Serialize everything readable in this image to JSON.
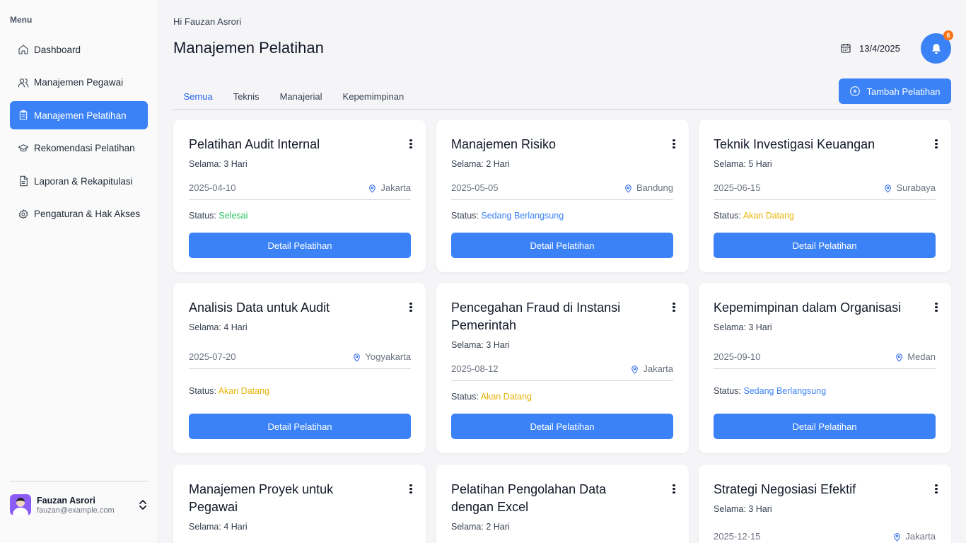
{
  "sidebar": {
    "menu_title": "Menu",
    "items": [
      {
        "label": "Dashboard",
        "icon": "home-icon"
      },
      {
        "label": "Manajemen Pegawai",
        "icon": "users-icon"
      },
      {
        "label": "Manajemen Pelatihan",
        "icon": "clipboard-icon",
        "active": true
      },
      {
        "label": "Rekomendasi Pelatihan",
        "icon": "graduation-cap-icon"
      },
      {
        "label": "Laporan & Rekapitulasi",
        "icon": "document-icon"
      },
      {
        "label": "Pengaturan & Hak Akses",
        "icon": "gear-icon"
      }
    ],
    "user": {
      "name": "Fauzan Asrori",
      "email": "fauzan@example.com"
    }
  },
  "header": {
    "greeting": "Hi Fauzan Asrori",
    "title": "Manajemen Pelatihan",
    "date": "13/4/2025",
    "notification_count": "6"
  },
  "tabs": [
    "Semua",
    "Teknis",
    "Manajerial",
    "Kepemimpinan"
  ],
  "add_button_label": "Tambah Pelatihan",
  "cards": [
    {
      "title": "Pelatihan Audit Internal",
      "duration": "Selama: 3 Hari",
      "date": "2025-04-10",
      "location": "Jakarta",
      "status_label": "Status: ",
      "status": "Selesai",
      "button": "Detail Pelatihan"
    },
    {
      "title": "Manajemen Risiko",
      "duration": "Selama: 2 Hari",
      "date": "2025-05-05",
      "location": "Bandung",
      "status_label": "Status: ",
      "status": "Sedang Berlangsung",
      "button": "Detail Pelatihan"
    },
    {
      "title": "Teknik Investigasi Keuangan",
      "duration": "Selama: 5 Hari",
      "date": "2025-06-15",
      "location": "Surabaya",
      "status_label": "Status: ",
      "status": "Akan Datang",
      "button": "Detail Pelatihan"
    },
    {
      "title": "Analisis Data untuk Audit",
      "duration": "Selama: 4 Hari",
      "date": "2025-07-20",
      "location": "Yogyakarta",
      "status_label": "Status: ",
      "status": "Akan Datang",
      "button": "Detail Pelatihan"
    },
    {
      "title": "Pencegahan Fraud di Instansi Pemerintah",
      "duration": "Selama: 3 Hari",
      "date": "2025-08-12",
      "location": "Jakarta",
      "status_label": "Status: ",
      "status": "Akan Datang",
      "button": "Detail Pelatihan"
    },
    {
      "title": "Kepemimpinan dalam Organisasi",
      "duration": "Selama: 3 Hari",
      "date": "2025-09-10",
      "location": "Medan",
      "status_label": "Status: ",
      "status": "Sedang Berlangsung",
      "button": "Detail Pelatihan"
    },
    {
      "title": "Manajemen Proyek untuk Pegawai",
      "duration": "Selama: 4 Hari"
    },
    {
      "title": "Pelatihan Pengolahan Data dengan Excel",
      "duration": "Selama: 2 Hari"
    },
    {
      "title": "Strategi Negosiasi Efektif",
      "duration": "Selama: 3 Hari",
      "date": "2025-12-15",
      "location": "Jakarta"
    }
  ],
  "colors": {
    "primary": "#3b82f6",
    "status_done": "#22c55e",
    "status_ongoing": "#3b82f6",
    "status_upcoming": "#eab308",
    "badge": "#f97316"
  }
}
